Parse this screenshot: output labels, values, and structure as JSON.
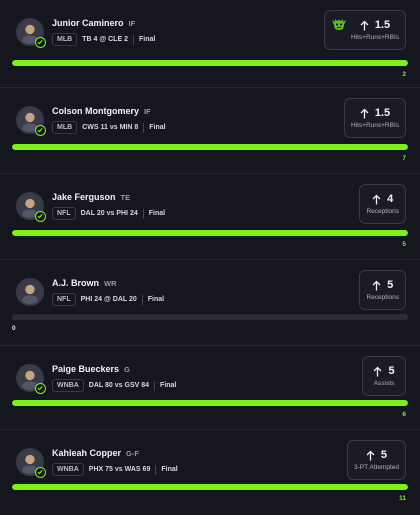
{
  "colors": {
    "background": "#16161f",
    "progress_fill": "#7cf21a",
    "progress_track": "#2c2c36"
  },
  "picks": [
    {
      "player": "Junior Caminero",
      "position": "IF",
      "league": "MLB",
      "away_team": "TB",
      "away_score": "4",
      "separator": "@",
      "home_team": "CLE",
      "home_score": "2",
      "status": "Final",
      "direction_icon": "arrow-up-icon",
      "line": "1.5",
      "stat": "Hits+Runs+RBIs",
      "badge_icon": "goblin-icon",
      "result": "2",
      "progress": 1.0
    },
    {
      "player": "Colson Montgomery",
      "position": "IF",
      "league": "MLB",
      "away_team": "CWS",
      "away_score": "11",
      "separator": "vs",
      "home_team": "MIN",
      "home_score": "8",
      "status": "Final",
      "direction_icon": "arrow-up-icon",
      "line": "1.5",
      "stat": "Hits+Runs+RBIs",
      "result": "7",
      "progress": 1.0
    },
    {
      "player": "Jake Ferguson",
      "position": "TE",
      "league": "NFL",
      "away_team": "DAL",
      "away_score": "20",
      "separator": "vs",
      "home_team": "PHI",
      "home_score": "24",
      "status": "Final",
      "direction_icon": "arrow-up-icon",
      "line": "4",
      "stat": "Receptions",
      "result": "5",
      "progress": 1.0
    },
    {
      "player": "A.J. Brown",
      "position": "WR",
      "league": "NFL",
      "away_team": "PHI",
      "away_score": "24",
      "separator": "@",
      "home_team": "DAL",
      "home_score": "20",
      "status": "Final",
      "direction_icon": "arrow-up-icon",
      "line": "5",
      "stat": "Receptions",
      "result": "0",
      "progress": 0.0
    },
    {
      "player": "Paige Bueckers",
      "position": "G",
      "league": "WNBA",
      "away_team": "DAL",
      "away_score": "80",
      "separator": "vs",
      "home_team": "GSV",
      "home_score": "84",
      "status": "Final",
      "direction_icon": "arrow-up-icon",
      "line": "5",
      "stat": "Assists",
      "result": "6",
      "progress": 1.0
    },
    {
      "player": "Kahleah Copper",
      "position": "G-F",
      "league": "WNBA",
      "away_team": "PHX",
      "away_score": "75",
      "separator": "vs",
      "home_team": "WAS",
      "home_score": "69",
      "status": "Final",
      "direction_icon": "arrow-up-icon",
      "line": "5",
      "stat": "3-PT Attempted",
      "result": "11",
      "progress": 1.0
    }
  ]
}
